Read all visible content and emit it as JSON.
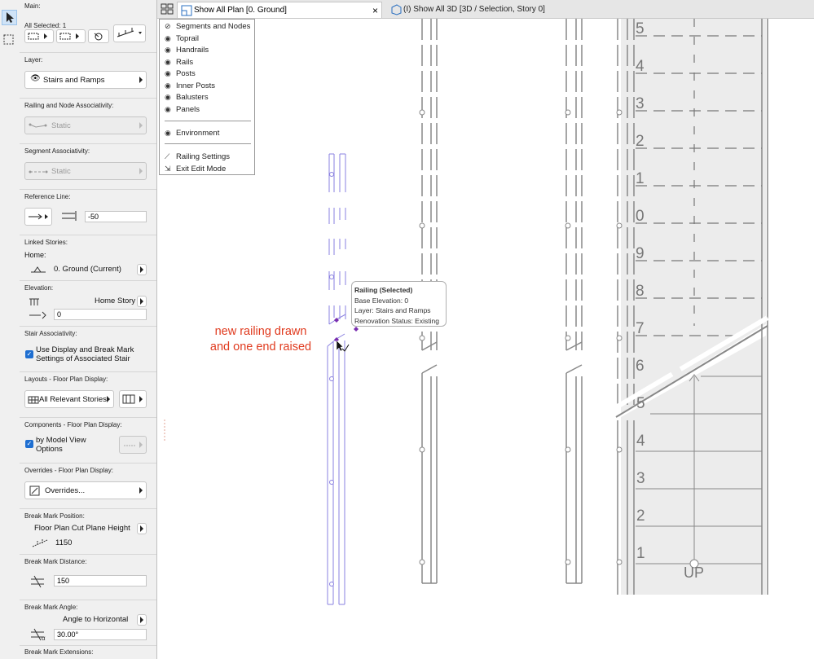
{
  "panel": {
    "main_label": "Main:",
    "selected_count": "All Selected: 1",
    "layer": {
      "label": "Layer:",
      "value": "Stairs and Ramps"
    },
    "node_assoc": {
      "label": "Railing and Node Associativity:",
      "value": "Static"
    },
    "segment_assoc": {
      "label": "Segment Associativity:",
      "value": "Static"
    },
    "reference_line": {
      "label": "Reference Line:",
      "offset": "-50"
    },
    "linked_stories": {
      "label": "Linked Stories:",
      "home_label": "Home:",
      "home_value": "0. Ground (Current)"
    },
    "elevation": {
      "label": "Elevation:",
      "story": "Home Story",
      "value": "0"
    },
    "stair_assoc": {
      "label": "Stair Associativity:",
      "checkbox_line1": "Use Display and Break Mark",
      "checkbox_line2": "Settings of Associated Stair"
    },
    "layouts": {
      "label": "Layouts - Floor Plan Display:",
      "value": "All Relevant Stories"
    },
    "components": {
      "label": "Components - Floor Plan Display:",
      "checkbox_line1": "by Model View",
      "checkbox_line2": "Options"
    },
    "overrides": {
      "label": "Overrides - Floor Plan Display:",
      "value": "Overrides..."
    },
    "break_position": {
      "label": "Break Mark Position:",
      "mode": "Floor Plan Cut Plane Height",
      "value": "1150"
    },
    "break_distance": {
      "label": "Break Mark Distance:",
      "value": "150"
    },
    "break_angle": {
      "label": "Break Mark Angle:",
      "mode": "Angle to Horizontal",
      "value": "30.00°"
    },
    "break_extensions": {
      "label": "Break Mark Extensions:"
    }
  },
  "tabs": {
    "plan": "Show All Plan [0. Ground]",
    "close": "×",
    "view3d": "(I) Show All 3D [3D / Selection, Story 0]"
  },
  "menu": {
    "items": [
      "Segments and Nodes",
      "Toprail",
      "Handrails",
      "Rails",
      "Posts",
      "Inner Posts",
      "Balusters",
      "Panels"
    ],
    "environment": "Environment",
    "railing_settings": "Railing Settings",
    "exit_edit": "Exit Edit Mode"
  },
  "tooltip": {
    "title": "Railing (Selected)",
    "line1": "Base Elevation: 0",
    "line2": "Layer: Stairs and Ramps",
    "line3": "Renovation Status: Existing"
  },
  "annotation": {
    "line1": "new railing drawn",
    "line2": "and one end raised",
    "color": "#e03a1e"
  },
  "stair": {
    "upper_numbers": [
      "5",
      "4",
      "3",
      "2",
      "1",
      "0",
      "9",
      "8",
      "7",
      "6"
    ],
    "lower_numbers": [
      "5",
      "4",
      "3",
      "2",
      "1"
    ],
    "up_label": "UP"
  },
  "colors": {
    "selection": "#8a80e0",
    "node": "#7a2fb0"
  }
}
